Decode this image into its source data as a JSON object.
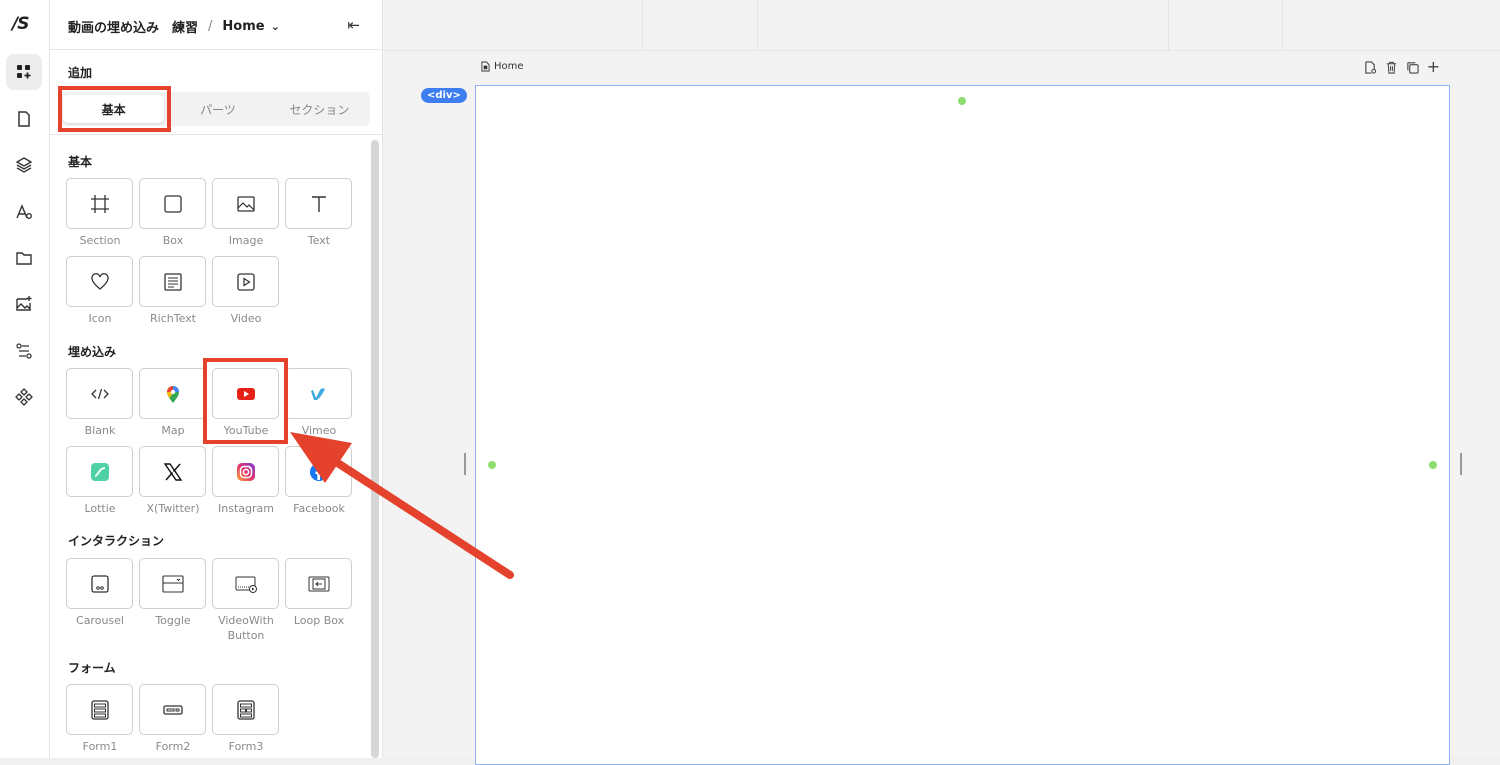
{
  "app": {
    "logo": "∕S"
  },
  "rail": {
    "items": [
      "add-icon",
      "page-icon",
      "layers-icon",
      "typography-icon",
      "folder-icon",
      "image-add-icon",
      "workflow-icon",
      "components-icon"
    ]
  },
  "header": {
    "project": "動画の埋め込み　練習",
    "separator": "/",
    "page": "Home",
    "chevron": "⌄",
    "collapse": "⇤"
  },
  "add": {
    "title": "追加",
    "tabs": [
      {
        "label": "基本"
      },
      {
        "label": "パーツ"
      },
      {
        "label": "セクション"
      }
    ]
  },
  "sections": {
    "basic": {
      "title": "基本",
      "items": [
        {
          "label": "Section"
        },
        {
          "label": "Box"
        },
        {
          "label": "Image"
        },
        {
          "label": "Text"
        },
        {
          "label": "Icon"
        },
        {
          "label": "RichText"
        },
        {
          "label": "Video"
        }
      ]
    },
    "embed": {
      "title": "埋め込み",
      "items": [
        {
          "label": "Blank"
        },
        {
          "label": "Map"
        },
        {
          "label": "YouTube"
        },
        {
          "label": "Vimeo"
        },
        {
          "label": "Lottie"
        },
        {
          "label": "X(Twitter)"
        },
        {
          "label": "Instagram"
        },
        {
          "label": "Facebook"
        }
      ]
    },
    "interaction": {
      "title": "インタラクション",
      "items": [
        {
          "label": "Carousel"
        },
        {
          "label": "Toggle"
        },
        {
          "label": "VideoWith\nButton"
        },
        {
          "label": "Loop Box"
        }
      ]
    },
    "form": {
      "title": "フォーム",
      "items": [
        {
          "label": "Form1"
        },
        {
          "label": "Form2"
        },
        {
          "label": "Form3"
        }
      ]
    }
  },
  "canvas": {
    "page_label": "Home",
    "element_badge": "<div>",
    "tools": [
      "doc-settings-icon",
      "trash-icon",
      "duplicate-icon",
      "plus-icon"
    ],
    "plus": "+"
  },
  "colors": {
    "accent": "#3f7ef1",
    "annotation": "#e5422d",
    "handle": "#8fdc6f"
  }
}
